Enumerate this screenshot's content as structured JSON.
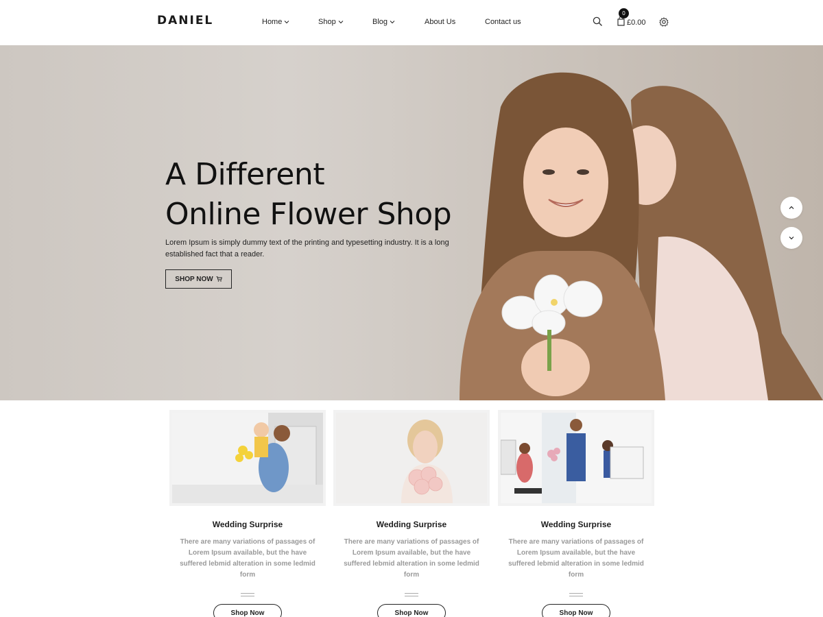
{
  "header": {
    "logo": "DANIEL",
    "nav": [
      {
        "label": "Home",
        "has_dropdown": true
      },
      {
        "label": "Shop",
        "has_dropdown": true
      },
      {
        "label": "Blog",
        "has_dropdown": true
      },
      {
        "label": "About Us",
        "has_dropdown": false
      },
      {
        "label": "Contact us",
        "has_dropdown": false
      }
    ],
    "cart_count": "0",
    "cart_total": "£0.00",
    "icons": [
      "search-icon",
      "cart-icon",
      "gear-icon"
    ]
  },
  "hero": {
    "title_line1": "A Different",
    "title_line2": "Online Flower Shop",
    "text": "Lorem Ipsum is simply dummy text of the printing and typesetting industry. It is a long established fact that a reader.",
    "button_label": "SHOP NOW",
    "slider_icons": [
      "chevron-up-icon",
      "chevron-down-icon"
    ]
  },
  "cards": [
    {
      "title": "Wedding Surprise",
      "description": "There are many variations of passages of Lorem Ipsum available, but the have suffered lebmid alteration in some ledmid form",
      "button": "Shop Now"
    },
    {
      "title": "Wedding Surprise",
      "description": "There are many variations of passages of Lorem Ipsum available, but the have suffered lebmid alteration in some ledmid form",
      "button": "Shop Now"
    },
    {
      "title": "Wedding Surprise",
      "description": "There are many variations of passages of Lorem Ipsum available, but the have suffered lebmid alteration in some ledmid form",
      "button": "Shop Now"
    }
  ],
  "colors": {
    "text": "#111111",
    "muted": "#999999",
    "hero_bg": "#d3cdc7"
  }
}
